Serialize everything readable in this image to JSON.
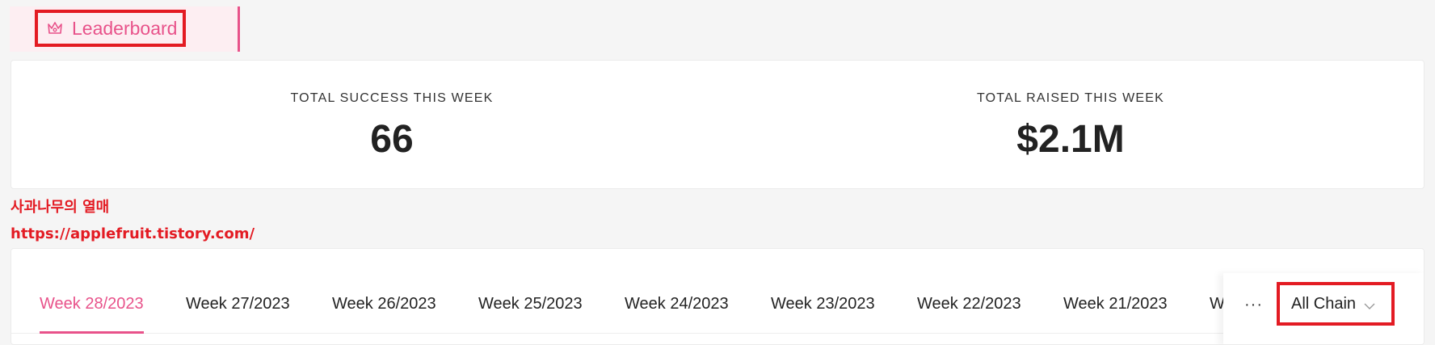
{
  "nav": {
    "label": "Leaderboard",
    "icon": "crown-icon"
  },
  "stats": {
    "success_label": "TOTAL SUCCESS THIS WEEK",
    "success_value": "66",
    "raised_label": "TOTAL RAISED THIS WEEK",
    "raised_value": "$2.1M"
  },
  "watermark": {
    "line1": "사과나무의 열매",
    "line2": "https://applefruit.tistory.com/"
  },
  "tabs": [
    {
      "label": "Week 28/2023"
    },
    {
      "label": "Week 27/2023"
    },
    {
      "label": "Week 26/2023"
    },
    {
      "label": "Week 25/2023"
    },
    {
      "label": "Week 24/2023"
    },
    {
      "label": "Week 23/2023"
    },
    {
      "label": "Week 22/2023"
    },
    {
      "label": "Week 21/2023"
    },
    {
      "label": "W"
    }
  ],
  "more_label": "···",
  "chain_select": {
    "value": "All Chain",
    "icon": "chevron-down-icon"
  },
  "colors": {
    "accent": "#e8528a",
    "highlight_box": "#e31b23"
  }
}
